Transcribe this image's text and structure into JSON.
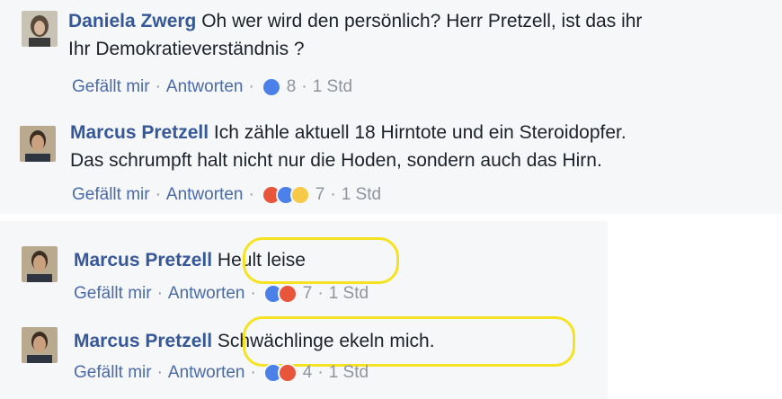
{
  "comments": [
    {
      "author": "Daniela Zwerg",
      "text_line1": " Oh wer wird den persönlich? Herr Pretzell, ist das ihr",
      "text_line2": "Ihr Demokratieverständnis ?",
      "like_label": "Gefällt mir",
      "reply_label": "Antworten",
      "reactions": [
        "like"
      ],
      "reaction_count": "8",
      "time": "1 Std"
    },
    {
      "author": "Marcus Pretzell",
      "text_line1": " Ich zähle aktuell 18 Hirntote und ein Steroidopfer.",
      "text_line2": "Das schrumpft halt nicht nur die Hoden, sondern auch das Hirn.",
      "like_label": "Gefällt mir",
      "reply_label": "Antworten",
      "reactions": [
        "angry",
        "like",
        "wow"
      ],
      "reaction_count": "7",
      "time": "1 Std"
    },
    {
      "author": "Marcus Pretzell",
      "text_line1": "Heult leise",
      "like_label": "Gefällt mir",
      "reply_label": "Antworten",
      "reactions": [
        "like",
        "angry"
      ],
      "reaction_count": "7",
      "time": "1 Std"
    },
    {
      "author": "Marcus Pretzell",
      "text_line1": "Schwächlinge ekeln mich.",
      "like_label": "Gefällt mir",
      "reply_label": "Antworten",
      "reactions": [
        "like",
        "angry"
      ],
      "reaction_count": "4",
      "time": "1 Std"
    }
  ],
  "separator": "·",
  "highlight_color": "#f5e321",
  "link_color": "#365899",
  "meta_link_color": "#4b6aa8",
  "muted_color": "#90949c"
}
